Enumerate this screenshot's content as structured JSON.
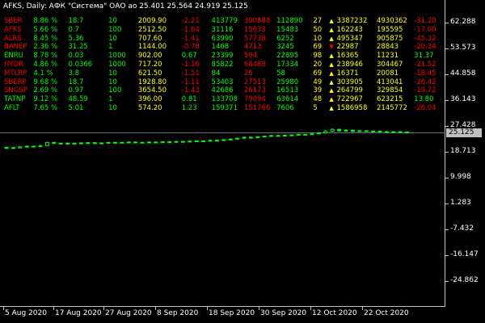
{
  "title": "AFKS, Daily:  АФК \"Система\" ОАО ао  25.401 25.564 24.919 25.125",
  "current_price": "25.125",
  "colors": {
    "up": "#00ff00",
    "down": "#ff0000",
    "neutral": "#ffff00",
    "grid": "#c0c0c0",
    "current_line": "#607080"
  },
  "tickers": [
    {
      "sym": "SBER",
      "sym_color": "#ff0000",
      "pct": "8.86 %",
      "c3": "18.7",
      "c4": "10",
      "price": "2009.90",
      "chg": "-2.21",
      "chg_color": "#ff0000",
      "vol": "413779",
      "v2": "300888",
      "v3": "112890",
      "n": "27",
      "arrow": "up",
      "a": "3387232",
      "b": "4930362",
      "last": "-31.20"
    },
    {
      "sym": "AFKS",
      "sym_color": "#ff0000",
      "pct": "5.66 %",
      "c3": "0.7",
      "c4": "100",
      "price": "2512.50",
      "chg": "-1.64",
      "chg_color": "#ff0000",
      "vol": "31116",
      "v2": "15633",
      "v3": "15483",
      "n": "50",
      "arrow": "up",
      "a": "162243",
      "b": "195595",
      "last": "-17.00"
    },
    {
      "sym": "ALRS",
      "sym_color": "#ff0000",
      "pct": "8.45 %",
      "c3": "5.36",
      "c4": "10",
      "price": "707.60",
      "chg": "-1.41",
      "chg_color": "#ff0000",
      "vol": "63990",
      "v2": "57738",
      "v3": "6252",
      "n": "10",
      "arrow": "up",
      "a": "495347",
      "b": "905875",
      "last": "-45.32"
    },
    {
      "sym": "BANEP",
      "sym_color": "#ff0000",
      "pct": "2.36 %",
      "c3": "31.25",
      "c4": "1",
      "price": "1144.00",
      "chg": "-0.78",
      "chg_color": "#ff0000",
      "vol": "1468",
      "v2": "4713",
      "v3": "3245",
      "n": "69",
      "arrow": "down",
      "a": "22987",
      "b": "28843",
      "last": "-20.34"
    },
    {
      "sym": "ENRU",
      "sym_color": "#00ff00",
      "pct": "8.78 %",
      "c3": "0.03",
      "c4": "1000",
      "price": "902.00",
      "chg": "0.67",
      "chg_color": "#00ff00",
      "vol": "23399",
      "v2": "504",
      "v3": "22895",
      "n": "98",
      "arrow": "up",
      "a": "16365",
      "b": "11231",
      "last": "31.37"
    },
    {
      "sym": "HYDR",
      "sym_color": "#ff0000",
      "pct": "4.86 %",
      "c3": "0.0366",
      "c4": "1000",
      "price": "717.20",
      "chg": "-1.16",
      "chg_color": "#ff0000",
      "vol": "85822",
      "v2": "68488",
      "v3": "17334",
      "n": "20",
      "arrow": "up",
      "a": "238946",
      "b": "304467",
      "last": "-21.52"
    },
    {
      "sym": "MTLRP",
      "sym_color": "#ff0000",
      "pct": "4.1 %",
      "c3": "3.8",
      "c4": "10",
      "price": "621.50",
      "chg": "-1.51",
      "chg_color": "#ff0000",
      "vol": "84",
      "v2": "26",
      "v3": "58",
      "n": "69",
      "arrow": "up",
      "a": "16371",
      "b": "20081",
      "last": "-18.45"
    },
    {
      "sym": "SBERP",
      "sym_color": "#ff0000",
      "pct": "9.68 %",
      "c3": "18.7",
      "c4": "10",
      "price": "1928.80",
      "chg": "-1.11",
      "chg_color": "#ff0000",
      "vol": "53403",
      "v2": "27513",
      "v3": "25980",
      "n": "49",
      "arrow": "up",
      "a": "303905",
      "b": "413041",
      "last": "-26.42"
    },
    {
      "sym": "SNGSP",
      "sym_color": "#ff0000",
      "pct": "2.69 %",
      "c3": "0.97",
      "c4": "100",
      "price": "3654.50",
      "chg": "-1.43",
      "chg_color": "#ff0000",
      "vol": "42686",
      "v2": "26173",
      "v3": "16513",
      "n": "39",
      "arrow": "up",
      "a": "264799",
      "b": "329854",
      "last": "-19.72"
    },
    {
      "sym": "TATNP",
      "sym_color": "#00ff00",
      "pct": "9.12 %",
      "c3": "48.59",
      "c4": "1",
      "price": "396.00",
      "chg": "0.81",
      "chg_color": "#00ff00",
      "vol": "133708",
      "v2": "70094",
      "v3": "63614",
      "n": "48",
      "arrow": "up",
      "a": "722967",
      "b": "623215",
      "last": "13.80"
    },
    {
      "sym": "AFLT",
      "sym_color": "#00ff00",
      "pct": "7.65 %",
      "c3": "5.01",
      "c4": "10",
      "price": "574.20",
      "chg": "1.23",
      "chg_color": "#00ff00",
      "vol": "159371",
      "v2": "151766",
      "v3": "7606",
      "n": "5",
      "arrow": "up",
      "a": "1586958",
      "b": "2145772",
      "last": "-26.04"
    }
  ],
  "y_axis": {
    "labels": [
      "62.288",
      "53.573",
      "44.858",
      "36.143",
      "27.428",
      "18.713",
      "9.998",
      "1.283",
      "-7.432",
      "-16.147",
      "-24.862"
    ],
    "min": -30,
    "max": 67
  },
  "x_axis": {
    "labels": [
      "5 Aug 2020",
      "17 Aug 2020",
      "27 Aug 2020",
      "8 Sep 2020",
      "18 Sep 2020",
      "30 Sep 2020",
      "12 Oct 2020",
      "22 Oct 2020"
    ]
  },
  "chart_data": {
    "type": "candlestick",
    "series": [
      {
        "o": 19.9,
        "c": 20.2,
        "h": 20.5,
        "l": 19.6
      },
      {
        "o": 20.1,
        "c": 20.0,
        "h": 20.4,
        "l": 19.8
      },
      {
        "o": 20.0,
        "c": 20.4,
        "h": 20.7,
        "l": 19.9
      },
      {
        "o": 20.4,
        "c": 20.6,
        "h": 20.9,
        "l": 20.2
      },
      {
        "o": 20.6,
        "c": 20.5,
        "h": 20.8,
        "l": 20.3
      },
      {
        "o": 20.5,
        "c": 20.8,
        "h": 21.0,
        "l": 20.4
      },
      {
        "o": 20.8,
        "c": 21.9,
        "h": 22.1,
        "l": 20.7
      },
      {
        "o": 21.9,
        "c": 21.6,
        "h": 22.0,
        "l": 21.3
      },
      {
        "o": 21.6,
        "c": 21.4,
        "h": 21.8,
        "l": 21.2
      },
      {
        "o": 21.4,
        "c": 21.6,
        "h": 21.9,
        "l": 21.2
      },
      {
        "o": 21.6,
        "c": 21.5,
        "h": 21.8,
        "l": 21.3
      },
      {
        "o": 21.5,
        "c": 21.7,
        "h": 22.0,
        "l": 21.3
      },
      {
        "o": 21.7,
        "c": 21.8,
        "h": 22.0,
        "l": 21.5
      },
      {
        "o": 21.8,
        "c": 21.6,
        "h": 22.0,
        "l": 21.4
      },
      {
        "o": 21.6,
        "c": 21.7,
        "h": 21.9,
        "l": 21.4
      },
      {
        "o": 21.7,
        "c": 21.9,
        "h": 22.1,
        "l": 21.5
      },
      {
        "o": 21.9,
        "c": 21.8,
        "h": 22.1,
        "l": 21.6
      },
      {
        "o": 21.8,
        "c": 21.9,
        "h": 22.1,
        "l": 21.6
      },
      {
        "o": 21.9,
        "c": 22.0,
        "h": 22.2,
        "l": 21.7
      },
      {
        "o": 22.0,
        "c": 21.8,
        "h": 22.2,
        "l": 21.6
      },
      {
        "o": 21.8,
        "c": 21.9,
        "h": 22.1,
        "l": 21.6
      },
      {
        "o": 21.9,
        "c": 22.0,
        "h": 22.2,
        "l": 21.7
      },
      {
        "o": 22.0,
        "c": 21.9,
        "h": 22.2,
        "l": 21.7
      },
      {
        "o": 21.9,
        "c": 22.1,
        "h": 22.3,
        "l": 21.7
      },
      {
        "o": 22.1,
        "c": 22.0,
        "h": 22.3,
        "l": 21.8
      },
      {
        "o": 22.0,
        "c": 22.2,
        "h": 22.4,
        "l": 21.8
      },
      {
        "o": 22.2,
        "c": 22.1,
        "h": 22.4,
        "l": 21.9
      },
      {
        "o": 22.1,
        "c": 22.3,
        "h": 22.5,
        "l": 21.9
      },
      {
        "o": 22.3,
        "c": 22.4,
        "h": 22.6,
        "l": 22.1
      },
      {
        "o": 22.4,
        "c": 22.3,
        "h": 22.6,
        "l": 22.1
      },
      {
        "o": 22.3,
        "c": 22.6,
        "h": 22.8,
        "l": 22.1
      },
      {
        "o": 22.6,
        "c": 22.5,
        "h": 22.9,
        "l": 22.3
      },
      {
        "o": 22.5,
        "c": 22.8,
        "h": 23.0,
        "l": 22.3
      },
      {
        "o": 22.8,
        "c": 23.0,
        "h": 23.3,
        "l": 22.6
      },
      {
        "o": 23.0,
        "c": 23.3,
        "h": 23.5,
        "l": 22.8
      },
      {
        "o": 23.3,
        "c": 23.6,
        "h": 23.9,
        "l": 23.1
      },
      {
        "o": 23.6,
        "c": 23.5,
        "h": 23.9,
        "l": 23.3
      },
      {
        "o": 23.5,
        "c": 23.8,
        "h": 24.0,
        "l": 23.3
      },
      {
        "o": 23.8,
        "c": 24.0,
        "h": 24.2,
        "l": 23.6
      },
      {
        "o": 24.0,
        "c": 24.2,
        "h": 24.4,
        "l": 23.8
      },
      {
        "o": 24.2,
        "c": 24.1,
        "h": 24.4,
        "l": 23.9
      },
      {
        "o": 24.1,
        "c": 24.3,
        "h": 24.5,
        "l": 23.9
      },
      {
        "o": 24.3,
        "c": 24.4,
        "h": 24.6,
        "l": 24.1
      },
      {
        "o": 24.4,
        "c": 24.6,
        "h": 24.8,
        "l": 24.2
      },
      {
        "o": 24.6,
        "c": 24.5,
        "h": 24.8,
        "l": 24.3
      },
      {
        "o": 24.5,
        "c": 24.8,
        "h": 25.0,
        "l": 24.3
      },
      {
        "o": 24.8,
        "c": 25.1,
        "h": 25.4,
        "l": 24.6
      },
      {
        "o": 25.1,
        "c": 25.6,
        "h": 26.2,
        "l": 24.9
      },
      {
        "o": 25.6,
        "c": 26.3,
        "h": 26.6,
        "l": 25.4
      },
      {
        "o": 26.3,
        "c": 25.8,
        "h": 26.5,
        "l": 25.6
      },
      {
        "o": 25.8,
        "c": 26.0,
        "h": 26.3,
        "l": 25.5
      },
      {
        "o": 26.0,
        "c": 25.6,
        "h": 26.2,
        "l": 25.4
      },
      {
        "o": 25.6,
        "c": 25.8,
        "h": 26.0,
        "l": 25.4
      },
      {
        "o": 25.8,
        "c": 25.6,
        "h": 26.0,
        "l": 25.4
      },
      {
        "o": 25.6,
        "c": 25.7,
        "h": 25.9,
        "l": 25.4
      },
      {
        "o": 25.7,
        "c": 25.5,
        "h": 25.9,
        "l": 25.3
      },
      {
        "o": 25.5,
        "c": 25.3,
        "h": 25.7,
        "l": 25.1
      },
      {
        "o": 25.3,
        "c": 25.5,
        "h": 25.7,
        "l": 25.1
      },
      {
        "o": 25.5,
        "c": 25.4,
        "h": 25.6,
        "l": 25.2
      },
      {
        "o": 25.4,
        "c": 25.125,
        "h": 25.564,
        "l": 24.919
      }
    ]
  }
}
